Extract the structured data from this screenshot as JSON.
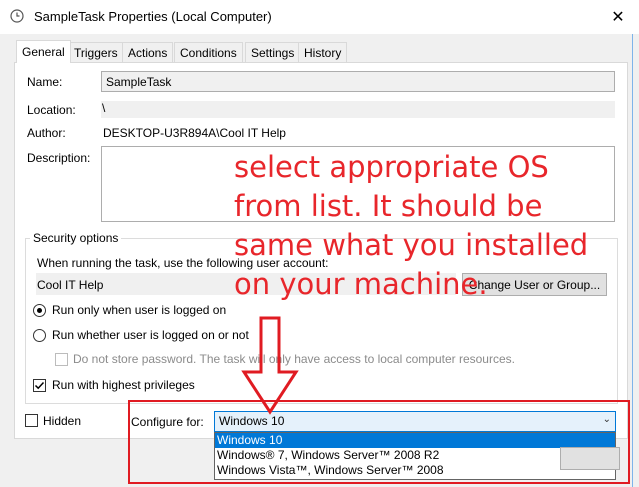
{
  "window": {
    "title": "SampleTask Properties (Local Computer)",
    "close_glyph": "✕"
  },
  "tabs": [
    {
      "label": "General"
    },
    {
      "label": "Triggers"
    },
    {
      "label": "Actions"
    },
    {
      "label": "Conditions"
    },
    {
      "label": "Settings"
    },
    {
      "label": "History"
    }
  ],
  "general": {
    "name_label": "Name:",
    "name_value": "SampleTask",
    "location_label": "Location:",
    "location_value": "\\",
    "author_label": "Author:",
    "author_value": "DESKTOP-U3R894A\\Cool IT Help",
    "description_label": "Description:"
  },
  "security": {
    "legend": "Security options",
    "prompt": "When running the task, use the following user account:",
    "account": "Cool IT Help",
    "change_button": "Change User or Group...",
    "radio_logged_on": "Run only when user is logged on",
    "radio_whether": "Run whether user is logged on or not",
    "no_store_password": "Do not store password.  The task will only have access to local computer resources.",
    "highest_privileges": "Run with highest privileges"
  },
  "footer": {
    "hidden_label": "Hidden",
    "configure_label": "Configure for:",
    "configure_value": "Windows 10",
    "options": [
      "Windows 10",
      "Windows® 7, Windows Server™ 2008 R2",
      "Windows Vista™, Windows Server™ 2008"
    ]
  },
  "annotation": {
    "lines": [
      "select appropriate OS",
      "from list. It should be",
      "same what you installed",
      "on your machine."
    ],
    "color": "#e8262b"
  },
  "colors": {
    "accent": "#0078d7",
    "annotation_red": "#e01b22"
  }
}
